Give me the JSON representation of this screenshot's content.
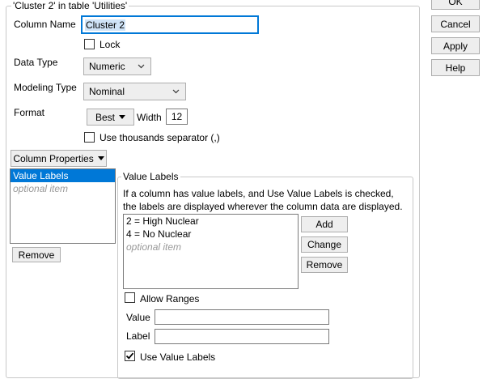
{
  "dialog": {
    "group_title": "'Cluster 2' in table 'Utilities'"
  },
  "side_buttons": {
    "ok": "OK",
    "cancel": "Cancel",
    "apply": "Apply",
    "help": "Help"
  },
  "form": {
    "column_name_label": "Column Name",
    "column_name_value": "Cluster 2",
    "lock_label": "Lock",
    "lock_checked": false,
    "data_type_label": "Data Type",
    "data_type_value": "Numeric",
    "modeling_type_label": "Modeling Type",
    "modeling_type_value": "Nominal",
    "format_label": "Format",
    "format_value": "Best",
    "width_label": "Width",
    "width_value": "12",
    "thousands_label": "Use thousands separator (,)",
    "thousands_checked": false
  },
  "column_properties": {
    "button_label": "Column Properties",
    "items": [
      {
        "label": "Value Labels",
        "selected": true
      },
      {
        "label": "optional item",
        "placeholder": true
      }
    ],
    "remove_label": "Remove"
  },
  "value_labels": {
    "title": "Value Labels",
    "description": "If a column has value labels, and Use Value Labels is checked, the labels are displayed wherever the column data are displayed.",
    "items": [
      {
        "label": "2 = High Nuclear"
      },
      {
        "label": "4 = No Nuclear"
      },
      {
        "label": "optional item",
        "placeholder": true
      }
    ],
    "add_label": "Add",
    "change_label": "Change",
    "remove_label": "Remove",
    "allow_ranges_label": "Allow Ranges",
    "allow_ranges_checked": false,
    "value_label": "Value",
    "value_input": "",
    "label_label": "Label",
    "label_input": "",
    "use_value_labels_label": "Use Value Labels",
    "use_value_labels_checked": true
  },
  "icons": {
    "dropdown": "chevron-down-icon",
    "menu_arrow": "triangle-down-icon",
    "check": "checkmark-icon"
  },
  "colors": {
    "selection": "#0078d7",
    "focus_border": "#0078d7",
    "button_bg": "#eeeeee"
  }
}
